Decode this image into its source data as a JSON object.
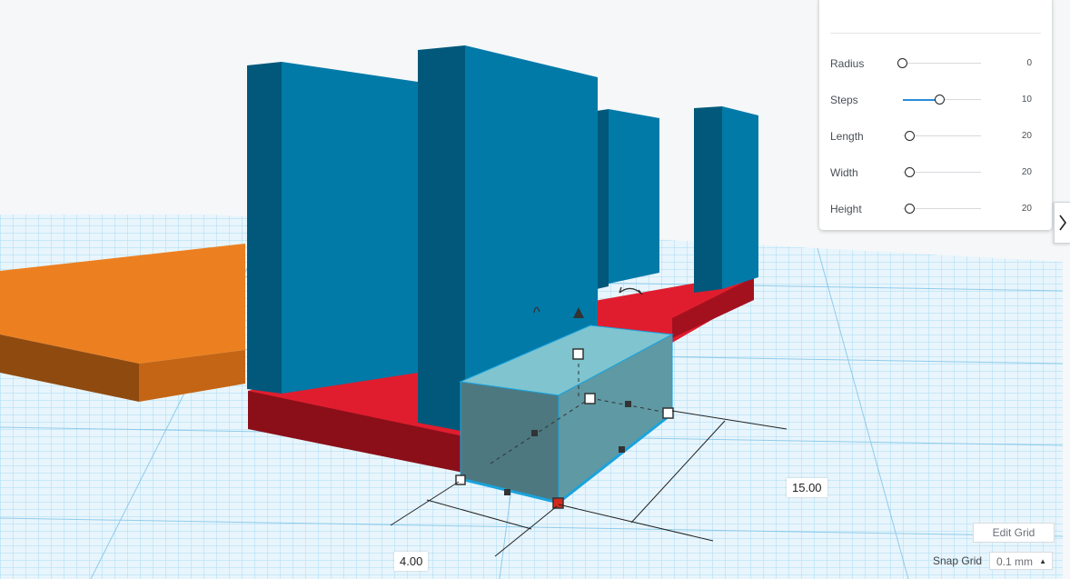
{
  "shape_panel": {
    "properties": [
      {
        "label": "Radius",
        "value": "0",
        "level": 0.0
      },
      {
        "label": "Steps",
        "value": "10",
        "level": 0.5
      },
      {
        "label": "Length",
        "value": "20",
        "level": 0.06
      },
      {
        "label": "Width",
        "value": "20",
        "level": 0.06
      },
      {
        "label": "Height",
        "value": "20",
        "level": 0.06
      }
    ]
  },
  "dimensions": {
    "length_value": "15.00",
    "width_value": "4.00"
  },
  "grid_controls": {
    "edit_grid_label": "Edit Grid",
    "snap_grid_label": "Snap Grid",
    "snap_grid_value": "0.1 mm"
  },
  "icons": {
    "collapse": "chevron-right-icon",
    "rotate": "rotate-arrow-icon",
    "lift": "cone-up-icon"
  },
  "colors": {
    "wall_blue": "#017aa8",
    "base_red": "#e01d2e",
    "orange_block": "#ec8020",
    "selected_box": "#5b8e97",
    "workplane_grid": "#9cd3ef"
  }
}
